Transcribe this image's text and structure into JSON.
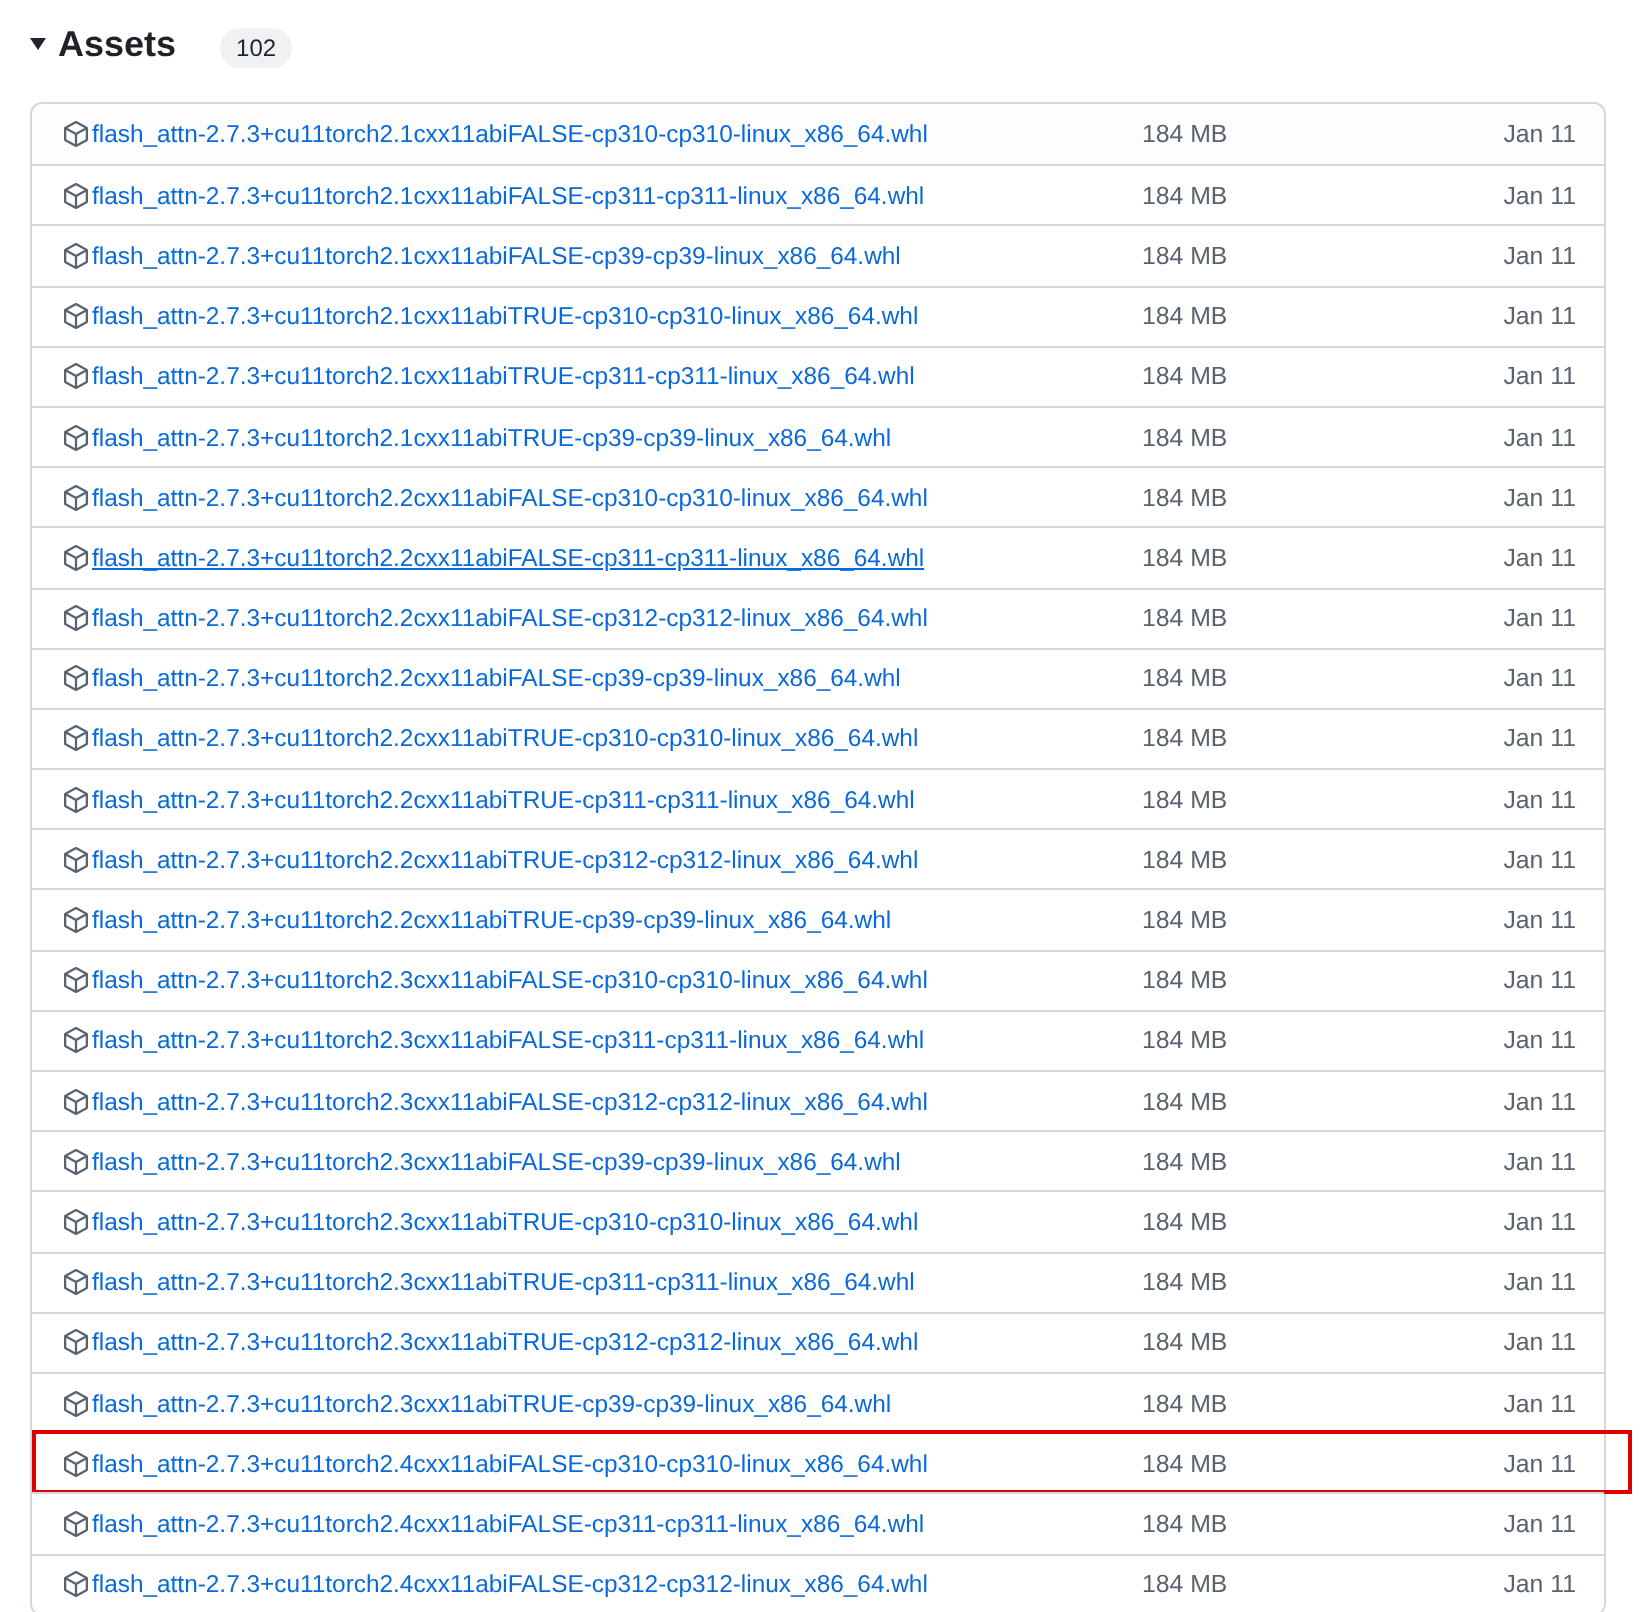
{
  "section": {
    "title": "Assets",
    "expanded": true,
    "count": "102"
  },
  "assets": [
    {
      "name": "flash_attn-2.7.3+cu11torch2.1cxx11abiFALSE-cp310-cp310-linux_x86_64.whl",
      "size": "184 MB",
      "date": "Jan 11",
      "hovered": false,
      "highlighted": false
    },
    {
      "name": "flash_attn-2.7.3+cu11torch2.1cxx11abiFALSE-cp311-cp311-linux_x86_64.whl",
      "size": "184 MB",
      "date": "Jan 11",
      "hovered": false,
      "highlighted": false
    },
    {
      "name": "flash_attn-2.7.3+cu11torch2.1cxx11abiFALSE-cp39-cp39-linux_x86_64.whl",
      "size": "184 MB",
      "date": "Jan 11",
      "hovered": false,
      "highlighted": false
    },
    {
      "name": "flash_attn-2.7.3+cu11torch2.1cxx11abiTRUE-cp310-cp310-linux_x86_64.whl",
      "size": "184 MB",
      "date": "Jan 11",
      "hovered": false,
      "highlighted": false
    },
    {
      "name": "flash_attn-2.7.3+cu11torch2.1cxx11abiTRUE-cp311-cp311-linux_x86_64.whl",
      "size": "184 MB",
      "date": "Jan 11",
      "hovered": false,
      "highlighted": false
    },
    {
      "name": "flash_attn-2.7.3+cu11torch2.1cxx11abiTRUE-cp39-cp39-linux_x86_64.whl",
      "size": "184 MB",
      "date": "Jan 11",
      "hovered": false,
      "highlighted": false
    },
    {
      "name": "flash_attn-2.7.3+cu11torch2.2cxx11abiFALSE-cp310-cp310-linux_x86_64.whl",
      "size": "184 MB",
      "date": "Jan 11",
      "hovered": false,
      "highlighted": false
    },
    {
      "name": "flash_attn-2.7.3+cu11torch2.2cxx11abiFALSE-cp311-cp311-linux_x86_64.whl",
      "size": "184 MB",
      "date": "Jan 11",
      "hovered": true,
      "highlighted": false
    },
    {
      "name": "flash_attn-2.7.3+cu11torch2.2cxx11abiFALSE-cp312-cp312-linux_x86_64.whl",
      "size": "184 MB",
      "date": "Jan 11",
      "hovered": false,
      "highlighted": false
    },
    {
      "name": "flash_attn-2.7.3+cu11torch2.2cxx11abiFALSE-cp39-cp39-linux_x86_64.whl",
      "size": "184 MB",
      "date": "Jan 11",
      "hovered": false,
      "highlighted": false
    },
    {
      "name": "flash_attn-2.7.3+cu11torch2.2cxx11abiTRUE-cp310-cp310-linux_x86_64.whl",
      "size": "184 MB",
      "date": "Jan 11",
      "hovered": false,
      "highlighted": false
    },
    {
      "name": "flash_attn-2.7.3+cu11torch2.2cxx11abiTRUE-cp311-cp311-linux_x86_64.whl",
      "size": "184 MB",
      "date": "Jan 11",
      "hovered": false,
      "highlighted": false
    },
    {
      "name": "flash_attn-2.7.3+cu11torch2.2cxx11abiTRUE-cp312-cp312-linux_x86_64.whl",
      "size": "184 MB",
      "date": "Jan 11",
      "hovered": false,
      "highlighted": false
    },
    {
      "name": "flash_attn-2.7.3+cu11torch2.2cxx11abiTRUE-cp39-cp39-linux_x86_64.whl",
      "size": "184 MB",
      "date": "Jan 11",
      "hovered": false,
      "highlighted": false
    },
    {
      "name": "flash_attn-2.7.3+cu11torch2.3cxx11abiFALSE-cp310-cp310-linux_x86_64.whl",
      "size": "184 MB",
      "date": "Jan 11",
      "hovered": false,
      "highlighted": false
    },
    {
      "name": "flash_attn-2.7.3+cu11torch2.3cxx11abiFALSE-cp311-cp311-linux_x86_64.whl",
      "size": "184 MB",
      "date": "Jan 11",
      "hovered": false,
      "highlighted": false
    },
    {
      "name": "flash_attn-2.7.3+cu11torch2.3cxx11abiFALSE-cp312-cp312-linux_x86_64.whl",
      "size": "184 MB",
      "date": "Jan 11",
      "hovered": false,
      "highlighted": false
    },
    {
      "name": "flash_attn-2.7.3+cu11torch2.3cxx11abiFALSE-cp39-cp39-linux_x86_64.whl",
      "size": "184 MB",
      "date": "Jan 11",
      "hovered": false,
      "highlighted": false
    },
    {
      "name": "flash_attn-2.7.3+cu11torch2.3cxx11abiTRUE-cp310-cp310-linux_x86_64.whl",
      "size": "184 MB",
      "date": "Jan 11",
      "hovered": false,
      "highlighted": false
    },
    {
      "name": "flash_attn-2.7.3+cu11torch2.3cxx11abiTRUE-cp311-cp311-linux_x86_64.whl",
      "size": "184 MB",
      "date": "Jan 11",
      "hovered": false,
      "highlighted": false
    },
    {
      "name": "flash_attn-2.7.3+cu11torch2.3cxx11abiTRUE-cp312-cp312-linux_x86_64.whl",
      "size": "184 MB",
      "date": "Jan 11",
      "hovered": false,
      "highlighted": false
    },
    {
      "name": "flash_attn-2.7.3+cu11torch2.3cxx11abiTRUE-cp39-cp39-linux_x86_64.whl",
      "size": "184 MB",
      "date": "Jan 11",
      "hovered": false,
      "highlighted": false
    },
    {
      "name": "flash_attn-2.7.3+cu11torch2.4cxx11abiFALSE-cp310-cp310-linux_x86_64.whl",
      "size": "184 MB",
      "date": "Jan 11",
      "hovered": false,
      "highlighted": true
    },
    {
      "name": "flash_attn-2.7.3+cu11torch2.4cxx11abiFALSE-cp311-cp311-linux_x86_64.whl",
      "size": "184 MB",
      "date": "Jan 11",
      "hovered": false,
      "highlighted": false
    },
    {
      "name": "flash_attn-2.7.3+cu11torch2.4cxx11abiFALSE-cp312-cp312-linux_x86_64.whl",
      "size": "184 MB",
      "date": "Jan 11",
      "hovered": false,
      "highlighted": false
    }
  ]
}
